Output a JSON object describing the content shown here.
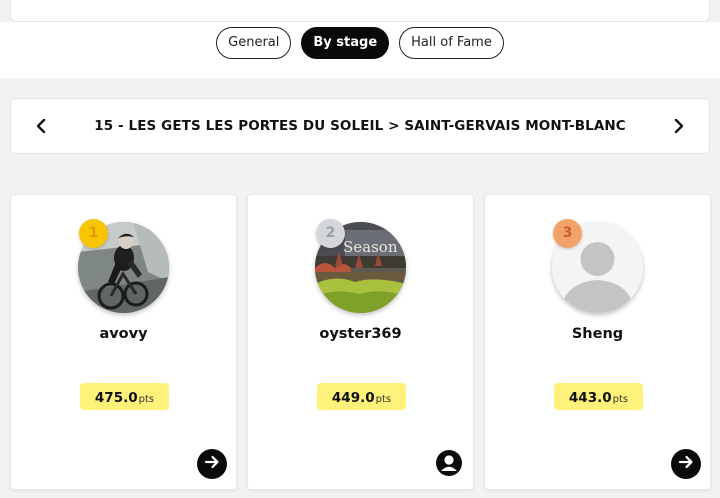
{
  "tabs": [
    {
      "label": "General",
      "active": false
    },
    {
      "label": "By stage",
      "active": true
    },
    {
      "label": "Hall of Fame",
      "active": false
    }
  ],
  "stage": {
    "title": "15 - LES GETS LES PORTES DU SOLEIL > SAINT-GERVAIS MONT-BLANC",
    "prev_icon": "chevron-left-icon",
    "next_icon": "chevron-right-icon"
  },
  "podium": [
    {
      "rank": "1",
      "rank_color": "#f7c400",
      "rank_text_color": "#e39a00",
      "username": "avovy",
      "points": "475.0",
      "unit": "pts",
      "avatar": "cyclist-photo",
      "action_icon": "arrow-right-icon"
    },
    {
      "rank": "2",
      "rank_color": "#d4d6dc",
      "rank_text_color": "#9aa0aa",
      "username": "oyster369",
      "points": "449.0",
      "unit": "pts",
      "avatar": "garden-photo",
      "action_icon": "user-icon"
    },
    {
      "rank": "3",
      "rank_color": "#f3a36a",
      "rank_text_color": "#c9612a",
      "username": "Sheng",
      "points": "443.0",
      "unit": "pts",
      "avatar": "default-avatar",
      "action_icon": "arrow-right-icon"
    }
  ],
  "colors": {
    "points_badge": "#fff27a",
    "accent": "#0a0a0a"
  }
}
